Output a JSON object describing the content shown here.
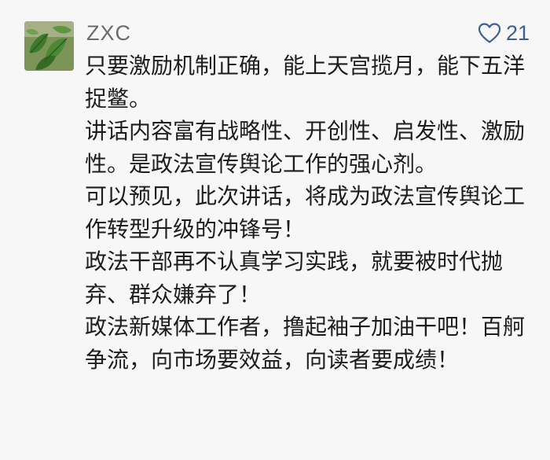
{
  "comment": {
    "author": "ZXC",
    "likes": "21",
    "avatar_icon": "plant-leaves-avatar",
    "like_icon": "heart-outline-icon",
    "like_color": "#3e5f91",
    "paragraphs": [
      "只要激励机制正确，能上天宫揽月，能下五洋捉鳖。",
      "讲话内容富有战略性、开创性、启发性、激励性。是政法宣传舆论工作的强心剂。",
      "可以预见，此次讲话，将成为政法宣传舆论工作转型升级的冲锋号！",
      "政法干部再不认真学习实践，就要被时代抛弃、群众嫌弃了！",
      "政法新媒体工作者，撸起袖子加油干吧！百舸争流，向市场要效益，向读者要成绩！"
    ]
  }
}
